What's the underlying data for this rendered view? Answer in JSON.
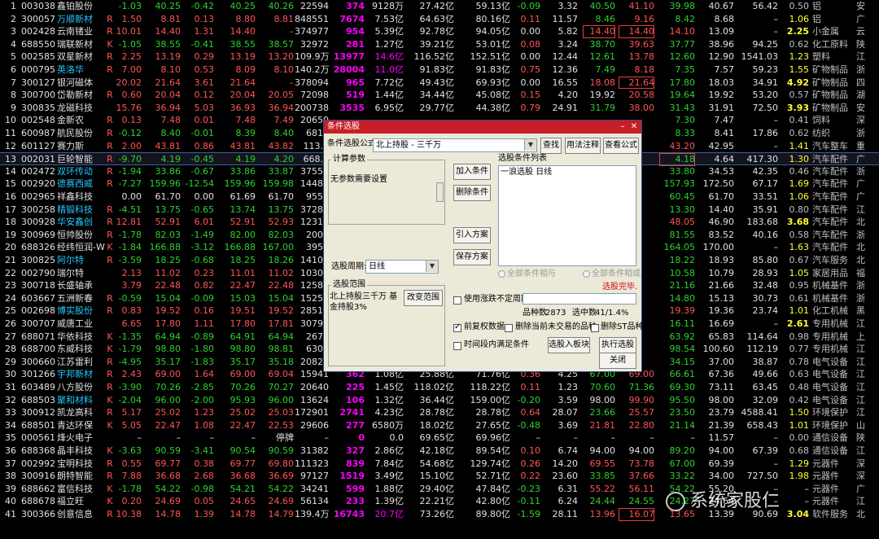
{
  "rows": [
    [
      "1",
      "003038",
      "鑫铂股份",
      "",
      "-1.03",
      "40.25",
      "-0.42",
      "40.25",
      "40.26",
      "22594",
      "374",
      "9128万",
      "27.42亿",
      "59.13亿",
      "-0.09",
      "3.32",
      "40.50",
      "41.10",
      "39.98",
      "40.67",
      "56.42",
      "0.50",
      "铝",
      "安"
    ],
    [
      "2",
      "300057",
      "万顺新材",
      "R",
      "1.50",
      "8.81",
      "0.13",
      "8.80",
      "8.81",
      "848551",
      "7674",
      "7.53亿",
      "64.63亿",
      "80.16亿",
      "0.11",
      "11.57",
      "8.46",
      "9.16",
      "8.42",
      "8.68",
      "–",
      "1.06",
      "铝",
      "广"
    ],
    [
      "3",
      "002428",
      "云南锗业",
      "R",
      "10.01",
      "14.40",
      "1.31",
      "14.40",
      "–",
      "374977",
      "954",
      "5.39亿",
      "92.78亿",
      "94.05亿",
      "0.00",
      "5.82",
      "14.40",
      "14.40",
      "14.10",
      "13.09",
      "–",
      "2.25",
      "小金属",
      "云"
    ],
    [
      "4",
      "688550",
      "瑞联新材",
      "K",
      "-1.05",
      "38.55",
      "-0.41",
      "38.55",
      "38.57",
      "32972",
      "281",
      "1.27亿",
      "39.21亿",
      "53.01亿",
      "0.08",
      "3.24",
      "38.70",
      "39.63",
      "37.77",
      "38.96",
      "94.25",
      "0.62",
      "化工原料",
      "陕"
    ],
    [
      "5",
      "002585",
      "双星新材",
      "R",
      "2.25",
      "13.19",
      "0.29",
      "13.19",
      "13.20",
      "109.9万",
      "13977",
      "14.6亿",
      "116.52亿",
      "152.51亿",
      "0.00",
      "12.44",
      "12.61",
      "13.78",
      "12.60",
      "12.90",
      "1541.03",
      "1.23",
      "塑料",
      "江"
    ],
    [
      "6",
      "000795",
      "英洛华",
      "R",
      "7.00",
      "8.10",
      "0.53",
      "8.09",
      "8.10",
      "140.2万",
      "28004",
      "11.0亿",
      "91.83亿",
      "91.83亿",
      "0.75",
      "12.36",
      "7.49",
      "8.18",
      "7.35",
      "7.57",
      "59.23",
      "1.55",
      "矿物制品",
      "浙"
    ],
    [
      "7",
      "300127",
      "银河磁体",
      "",
      "20.02",
      "21.64",
      "3.61",
      "21.64",
      "–",
      "378094",
      "965",
      "7.72亿",
      "49.43亿",
      "69.93亿",
      "0.00",
      "16.55",
      "18.08",
      "21.64",
      "17.80",
      "18.03",
      "34.91",
      "4.92",
      "矿物制品",
      "四"
    ],
    [
      "8",
      "300700",
      "岱勒新材",
      "R",
      "0.60",
      "20.04",
      "0.12",
      "20.04",
      "20.05",
      "72098",
      "519",
      "1.44亿",
      "34.44亿",
      "45.08亿",
      "0.15",
      "4.20",
      "19.92",
      "20.58",
      "19.64",
      "19.92",
      "53.20",
      "0.57",
      "矿物制品",
      "湖"
    ],
    [
      "9",
      "300835",
      "龙磁科技",
      "",
      "15.76",
      "36.94",
      "5.03",
      "36.93",
      "36.94",
      "200738",
      "3535",
      "6.95亿",
      "29.77亿",
      "44.38亿",
      "0.79",
      "24.91",
      "31.79",
      "38.00",
      "31.43",
      "31.91",
      "72.50",
      "3.93",
      "矿物制品",
      "安"
    ],
    [
      "10",
      "002548",
      "金新农",
      "R",
      "0.13",
      "7.48",
      "0.01",
      "7.48",
      "7.49",
      "20650",
      "",
      "",
      "",
      "",
      "",
      "",
      "",
      "",
      "7.30",
      "7.47",
      "–",
      "0.41",
      "饲料",
      "深"
    ],
    [
      "11",
      "600987",
      "航民股份",
      "R",
      "-0.12",
      "8.40",
      "-0.01",
      "8.39",
      "8.40",
      "6817",
      "",
      "",
      "",
      "",
      "",
      "",
      "",
      "",
      "8.33",
      "8.41",
      "17.86",
      "0.62",
      "纺织",
      "浙"
    ],
    [
      "12",
      "601127",
      "赛力斯",
      "R",
      "2.00",
      "43.81",
      "0.86",
      "43.81",
      "43.82",
      "113.2",
      "",
      "",
      "",
      "",
      "",
      "",
      "",
      "",
      "43.20",
      "42.95",
      "–",
      "1.41",
      "汽车整车",
      "重"
    ],
    [
      "13",
      "002031",
      "巨轮智能",
      "R",
      "-9.70",
      "4.19",
      "-0.45",
      "4.19",
      "4.20",
      "668.0",
      "",
      "",
      "",
      "",
      "",
      "",
      "",
      "",
      "4.18",
      "4.64",
      "417.30",
      "1.30",
      "汽车配件",
      "广"
    ],
    [
      "14",
      "002472",
      "双环传动",
      "R",
      "-1.94",
      "33.86",
      "-0.67",
      "33.86",
      "33.87",
      "37552",
      "",
      "",
      "",
      "",
      "",
      "",
      "",
      "",
      "33.80",
      "34.53",
      "42.35",
      "0.46",
      "汽车配件",
      "浙"
    ],
    [
      "15",
      "002920",
      "德赛西威",
      "R",
      "-7.27",
      "159.96",
      "-12.54",
      "159.96",
      "159.98",
      "14481",
      "",
      "",
      "",
      "",
      "",
      "",
      "",
      "",
      "157.93",
      "172.50",
      "67.17",
      "1.69",
      "汽车配件",
      "广"
    ],
    [
      "16",
      "002965",
      "祥鑫科技",
      "",
      "0.00",
      "61.70",
      "0.00",
      "61.69",
      "61.70",
      "9554",
      "",
      "",
      "",
      "",
      "",
      "",
      "",
      "",
      "60.45",
      "61.70",
      "33.51",
      "1.06",
      "汽车配件",
      "广"
    ],
    [
      "17",
      "300258",
      "精锻科技",
      "R",
      "-4.51",
      "13.75",
      "-0.65",
      "13.74",
      "13.75",
      "37284",
      "",
      "",
      "",
      "",
      "",
      "",
      "",
      "",
      "13.30",
      "14.40",
      "35.91",
      "0.80",
      "汽车配件",
      "江"
    ],
    [
      "18",
      "300928",
      "华安鑫创",
      "R",
      "12.81",
      "52.91",
      "6.01",
      "52.91",
      "52.93",
      "12315",
      "",
      "",
      "",
      "",
      "",
      "",
      "",
      "",
      "48.05",
      "46.90",
      "183.68",
      "3.68",
      "汽车配件",
      "北"
    ],
    [
      "19",
      "300969",
      "恒帅股份",
      "R",
      "-1.78",
      "82.03",
      "-1.49",
      "82.00",
      "82.03",
      "2001",
      "",
      "",
      "",
      "",
      "",
      "",
      "",
      "",
      "81.55",
      "83.52",
      "40.16",
      "0.58",
      "汽车配件",
      "浙"
    ],
    [
      "20",
      "688326",
      "经纬恒润-W",
      "K",
      "-1.84",
      "166.88",
      "-3.12",
      "166.88",
      "167.00",
      "3953",
      "",
      "",
      "",
      "",
      "",
      "",
      "",
      "",
      "164.05",
      "170.00",
      "–",
      "1.63",
      "汽车配件",
      "北"
    ],
    [
      "21",
      "300825",
      "阿尔特",
      "R",
      "-3.59",
      "18.25",
      "-0.68",
      "18.25",
      "18.26",
      "14101",
      "",
      "",
      "",
      "",
      "",
      "",
      "",
      "",
      "18.22",
      "18.93",
      "85.80",
      "0.67",
      "汽车服务",
      "北"
    ],
    [
      "22",
      "002790",
      "瑞尔特",
      "",
      "2.13",
      "11.02",
      "0.23",
      "11.01",
      "11.02",
      "10308",
      "",
      "",
      "",
      "",
      "",
      "",
      "",
      "",
      "10.58",
      "10.79",
      "28.93",
      "1.05",
      "家居用品",
      "福"
    ],
    [
      "23",
      "300718",
      "长盛轴承",
      "",
      "3.79",
      "22.48",
      "0.82",
      "22.47",
      "22.48",
      "12580",
      "",
      "",
      "",
      "",
      "",
      "",
      "",
      "",
      "21.16",
      "21.66",
      "32.48",
      "0.95",
      "机械基件",
      "浙"
    ],
    [
      "24",
      "603667",
      "五洲新春",
      "R",
      "-0.59",
      "15.04",
      "-0.09",
      "15.03",
      "15.04",
      "15259",
      "",
      "",
      "",
      "",
      "",
      "",
      "",
      "",
      "14.80",
      "15.13",
      "30.73",
      "0.61",
      "机械基件",
      "浙"
    ],
    [
      "25",
      "002698",
      "博实股份",
      "R",
      "0.83",
      "19.52",
      "0.16",
      "19.51",
      "19.52",
      "28512",
      "",
      "",
      "",
      "",
      "",
      "",
      "",
      "",
      "19.39",
      "19.36",
      "23.74",
      "1.01",
      "化工机械",
      "黑"
    ],
    [
      "26",
      "300707",
      "威唐工业",
      "",
      "6.65",
      "17.80",
      "1.11",
      "17.80",
      "17.81",
      "30799",
      "",
      "",
      "",
      "",
      "",
      "",
      "",
      "",
      "16.11",
      "16.69",
      "–",
      "2.61",
      "专用机械",
      "江"
    ],
    [
      "27",
      "688071",
      "华依科技",
      "K",
      "-1.35",
      "64.94",
      "-0.89",
      "64.91",
      "64.94",
      "2676",
      "",
      "",
      "",
      "",
      "",
      "",
      "",
      "",
      "63.92",
      "65.83",
      "114.64",
      "0.98",
      "专用机械",
      "上"
    ],
    [
      "28",
      "688700",
      "东威科技",
      "K",
      "-1.79",
      "98.80",
      "-1.80",
      "98.80",
      "98.81",
      "6307",
      "",
      "",
      "",
      "",
      "",
      "",
      "",
      "",
      "98.54",
      "100.60",
      "112.19",
      "0.77",
      "专用机械",
      "江"
    ],
    [
      "29",
      "300660",
      "江苏雷利",
      "R",
      "-4.95",
      "35.17",
      "-1.83",
      "35.17",
      "35.18",
      "20828",
      "",
      "",
      "",
      "",
      "",
      "",
      "",
      "",
      "34.15",
      "37.00",
      "38.87",
      "0.78",
      "电气设备",
      "江"
    ],
    [
      "30",
      "301266",
      "宇邦新材",
      "R",
      "2.43",
      "69.00",
      "1.64",
      "69.00",
      "69.04",
      "15941",
      "362",
      "1.08亿",
      "25.88亿",
      "71.76亿",
      "0.36",
      "4.25",
      "67.00",
      "69.00",
      "66.61",
      "67.36",
      "49.66",
      "0.63",
      "电气设备",
      "江"
    ],
    [
      "31",
      "603489",
      "八方股份",
      "R",
      "-3.90",
      "70.26",
      "-2.85",
      "70.26",
      "70.27",
      "20640",
      "225",
      "1.45亿",
      "118.02亿",
      "118.22亿",
      "0.11",
      "1.23",
      "70.60",
      "71.36",
      "69.30",
      "73.11",
      "63.45",
      "0.48",
      "电气设备",
      "江"
    ],
    [
      "32",
      "688503",
      "聚和材料",
      "K",
      "-2.04",
      "96.00",
      "-2.00",
      "95.93",
      "96.00",
      "13624",
      "106",
      "1.32亿",
      "36.44亿",
      "159.00亿",
      "-0.20",
      "3.59",
      "98.00",
      "99.90",
      "95.50",
      "98.00",
      "32.09",
      "0.42",
      "电气设备",
      "江"
    ],
    [
      "33",
      "300912",
      "凯龙高科",
      "R",
      "5.17",
      "25.02",
      "1.23",
      "25.02",
      "25.03",
      "172901",
      "2741",
      "4.23亿",
      "28.78亿",
      "28.78亿",
      "0.64",
      "28.07",
      "23.66",
      "25.57",
      "23.50",
      "23.79",
      "4588.41",
      "1.50",
      "环境保护",
      "江"
    ],
    [
      "34",
      "688501",
      "青达环保",
      "K",
      "5.05",
      "22.47",
      "1.08",
      "22.47",
      "22.53",
      "29606",
      "277",
      "6580万",
      "18.02亿",
      "27.65亿",
      "-0.48",
      "3.69",
      "21.81",
      "22.80",
      "21.14",
      "21.39",
      "658.43",
      "1.01",
      "环境保护",
      "山"
    ],
    [
      "35",
      "000561",
      "烽火电子",
      "",
      "–",
      "–",
      "–",
      "–",
      "停牌",
      "–",
      "0",
      "0.0",
      "69.65亿",
      "69.96亿",
      "–",
      "–",
      "–",
      "–",
      "–",
      "11.57",
      "–",
      "0.00",
      "通信设备",
      "陕"
    ],
    [
      "36",
      "688368",
      "晶丰科技",
      "K",
      "-3.63",
      "90.59",
      "-3.41",
      "90.54",
      "90.59",
      "31382",
      "327",
      "2.86亿",
      "42.18亿",
      "89.54亿",
      "0.10",
      "6.74",
      "94.00",
      "94.00",
      "89.20",
      "94.00",
      "67.39",
      "0.68",
      "通信设备",
      "江"
    ],
    [
      "37",
      "002992",
      "宝明科技",
      "R",
      "0.55",
      "69.77",
      "0.38",
      "69.77",
      "69.80",
      "111323",
      "839",
      "7.84亿",
      "54.68亿",
      "129.74亿",
      "0.26",
      "14.20",
      "69.55",
      "73.78",
      "67.00",
      "69.39",
      "–",
      "1.29",
      "元器件",
      "深"
    ],
    [
      "38",
      "300916",
      "朗特智能",
      "R",
      "7.88",
      "36.68",
      "2.68",
      "36.68",
      "36.69",
      "97127",
      "1519",
      "3.49亿",
      "15.10亿",
      "52.71亿",
      "0.22",
      "23.60",
      "33.85",
      "37.66",
      "33.22",
      "34.00",
      "727.50",
      "1.98",
      "元器件",
      "深"
    ],
    [
      "39",
      "688662",
      "富信科技",
      "K",
      "-1.78",
      "54.22",
      "-0.98",
      "54.21",
      "54.22",
      "34241",
      "599",
      "1.88亿",
      "29.40亿",
      "47.84亿",
      "-0.23",
      "6.31",
      "55.22",
      "56.11",
      "54.22",
      "55.20",
      "–",
      "–",
      "元器件",
      "广"
    ],
    [
      "40",
      "688678",
      "福立旺",
      "K",
      "0.20",
      "24.69",
      "0.05",
      "24.65",
      "24.69",
      "56134",
      "233",
      "1.39亿",
      "22.21亿",
      "42.80亿",
      "-0.11",
      "6.24",
      "24.44",
      "24.55",
      "24.27",
      "24.64",
      "–",
      "–",
      "元器件",
      "江"
    ],
    [
      "41",
      "300366",
      "创意信息",
      "R",
      "10.38",
      "14.78",
      "1.39",
      "14.78",
      "14.79",
      "139.4万",
      "16743",
      "20.7亿",
      "73.26亿",
      "89.80亿",
      "-1.59",
      "28.11",
      "13.96",
      "16.07",
      "13.65",
      "13.39",
      "90.69",
      "3.04",
      "软件服务",
      "北"
    ]
  ],
  "dialog": {
    "title": "条件选股",
    "formula_label": "条件选股公式",
    "formula_value": "北上持股    - 三千万",
    "btn_find": "查找",
    "btn_usage": "用法注释",
    "btn_view": "查看公式",
    "params_title": "计算参数",
    "params_text": "无参数需要设置",
    "btn_add": "加入条件",
    "btn_del": "删除条件",
    "btn_import": "引入方案",
    "btn_save": "保存方案",
    "list_title": "选股条件列表",
    "list_items": [
      "一浪选股  日线"
    ],
    "radio_and": "全部条件相与",
    "radio_or": "全部条件相或",
    "period_label": "选股周期:",
    "period_value": "日线",
    "status_text": "选股完毕.",
    "range_title": "选股范围",
    "range_text": "北上持股三千万 基金持股3%",
    "btn_range": "改变范围",
    "cb_uncertain": "使用涨跌不定周期",
    "count_total_label": "品种数",
    "count_total": "2873",
    "count_sel_label": "选中数",
    "count_sel": "41/1.4%",
    "cb_pre": "前复权数据",
    "cb_del_untraded": "删除当前未交易的品种",
    "cb_del_st": "删除ST品种",
    "cb_period": "时间段内满足条件",
    "btn_to_block": "选股入板块",
    "btn_run": "执行选股",
    "btn_close": "关闭"
  },
  "watermark": "系统家股仁",
  "colors": {
    "up": "#ff5555",
    "down": "#2fd22f",
    "titlebar": "#c81e28"
  }
}
